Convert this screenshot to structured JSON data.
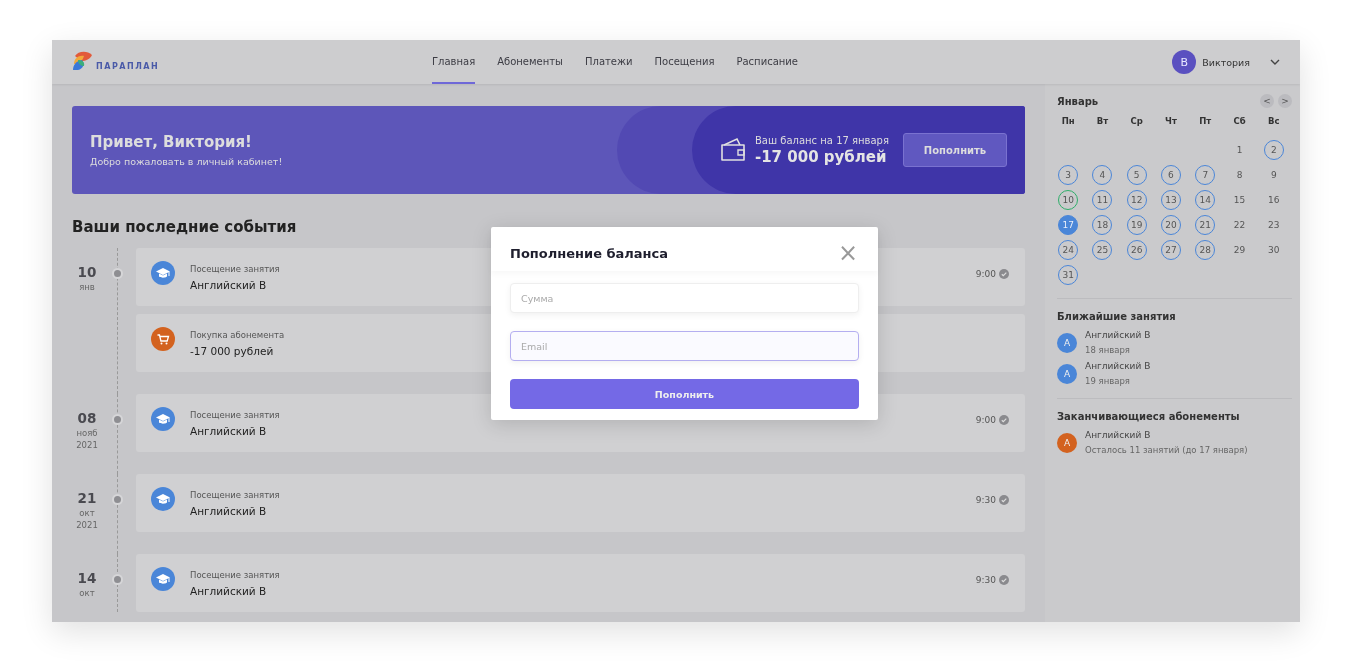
{
  "header": {
    "logo_text": "ПАРАПЛАН",
    "nav": [
      {
        "label": "Главная",
        "selected": true
      },
      {
        "label": "Абонементы",
        "selected": false
      },
      {
        "label": "Платежи",
        "selected": false
      },
      {
        "label": "Посещения",
        "selected": false
      },
      {
        "label": "Расписание",
        "selected": false
      }
    ],
    "user": {
      "initial": "В",
      "name": "Виктория"
    }
  },
  "banner": {
    "greeting": "Привет, Виктория!",
    "subtitle": "Добро пожаловать в личный кабинет!",
    "balance_label": "Ваш баланс на 17 января",
    "balance": "-17 000 рублей",
    "button": "Пополнить"
  },
  "events": {
    "title": "Ваши последние события",
    "groups": [
      {
        "day": "10",
        "month": "янв",
        "events": [
          {
            "kind": "visit",
            "label": "Посещение занятия",
            "title": "Английский В",
            "time": "9:00"
          },
          {
            "kind": "purchase",
            "label": "Покупка абонемента",
            "title": "-17 000 рублей"
          }
        ]
      },
      {
        "day": "08",
        "month": "нояб",
        "year": "2021",
        "events": [
          {
            "kind": "visit",
            "label": "Посещение занятия",
            "title": "Английский В",
            "time": "9:00"
          }
        ]
      },
      {
        "day": "21",
        "month": "окт",
        "year": "2021",
        "events": [
          {
            "kind": "visit",
            "label": "Посещение занятия",
            "title": "Английский В",
            "time": "9:30"
          }
        ]
      },
      {
        "day": "14",
        "month": "окт",
        "events": [
          {
            "kind": "visit",
            "label": "Посещение занятия",
            "title": "Английский В",
            "time": "9:30"
          }
        ]
      }
    ]
  },
  "calendar": {
    "month": "Январь",
    "prev": "<",
    "next": ">",
    "weekdays": [
      "Пн",
      "Вт",
      "Ср",
      "Чт",
      "Пт",
      "Сб",
      "Вс"
    ],
    "weeks": [
      [
        {
          "day": "1",
          "kind": "plain"
        },
        {
          "day": "2",
          "kind": "booked"
        }
      ],
      [
        {
          "day": "3",
          "kind": "booked"
        },
        {
          "day": "4",
          "kind": "booked"
        },
        {
          "day": "5",
          "kind": "booked"
        },
        {
          "day": "6",
          "kind": "booked"
        },
        {
          "day": "7",
          "kind": "booked"
        },
        {
          "day": "8",
          "kind": "plain"
        },
        {
          "day": "9",
          "kind": "plain"
        }
      ],
      [
        {
          "day": "10",
          "kind": "attended"
        },
        {
          "day": "11",
          "kind": "booked"
        },
        {
          "day": "12",
          "kind": "booked"
        },
        {
          "day": "13",
          "kind": "booked"
        },
        {
          "day": "14",
          "kind": "booked"
        },
        {
          "day": "15",
          "kind": "plain"
        },
        {
          "day": "16",
          "kind": "plain"
        }
      ],
      [
        {
          "day": "17",
          "kind": "today"
        },
        {
          "day": "18",
          "kind": "booked"
        },
        {
          "day": "19",
          "kind": "booked"
        },
        {
          "day": "20",
          "kind": "booked"
        },
        {
          "day": "21",
          "kind": "booked"
        },
        {
          "day": "22",
          "kind": "plain"
        },
        {
          "day": "23",
          "kind": "plain"
        }
      ],
      [
        {
          "day": "24",
          "kind": "booked"
        },
        {
          "day": "25",
          "kind": "booked"
        },
        {
          "day": "26",
          "kind": "booked"
        },
        {
          "day": "27",
          "kind": "booked"
        },
        {
          "day": "28",
          "kind": "booked"
        },
        {
          "day": "29",
          "kind": "plain"
        },
        {
          "day": "30",
          "kind": "plain"
        }
      ],
      [
        {
          "day": "31",
          "kind": "booked"
        }
      ]
    ]
  },
  "upcoming": {
    "title": "Ближайшие занятия",
    "items": [
      {
        "initial": "А",
        "name": "Английский В",
        "detail": "18 января",
        "color": "#4a86d8"
      },
      {
        "initial": "А",
        "name": "Английский В",
        "detail": "19 января",
        "color": "#4a86d8"
      }
    ]
  },
  "expiring": {
    "title": "Заканчивающиеся абонементы",
    "items": [
      {
        "initial": "А",
        "name": "Английский В",
        "detail": "Осталось 11 занятий (до 17 января)",
        "color": "#d3621f"
      }
    ]
  },
  "modal": {
    "title": "Пополнение баланса",
    "close": "×",
    "fields": [
      {
        "placeholder": "Сумма",
        "focused": false
      },
      {
        "placeholder": "Email",
        "focused": true
      }
    ],
    "button": "Пополнить"
  }
}
